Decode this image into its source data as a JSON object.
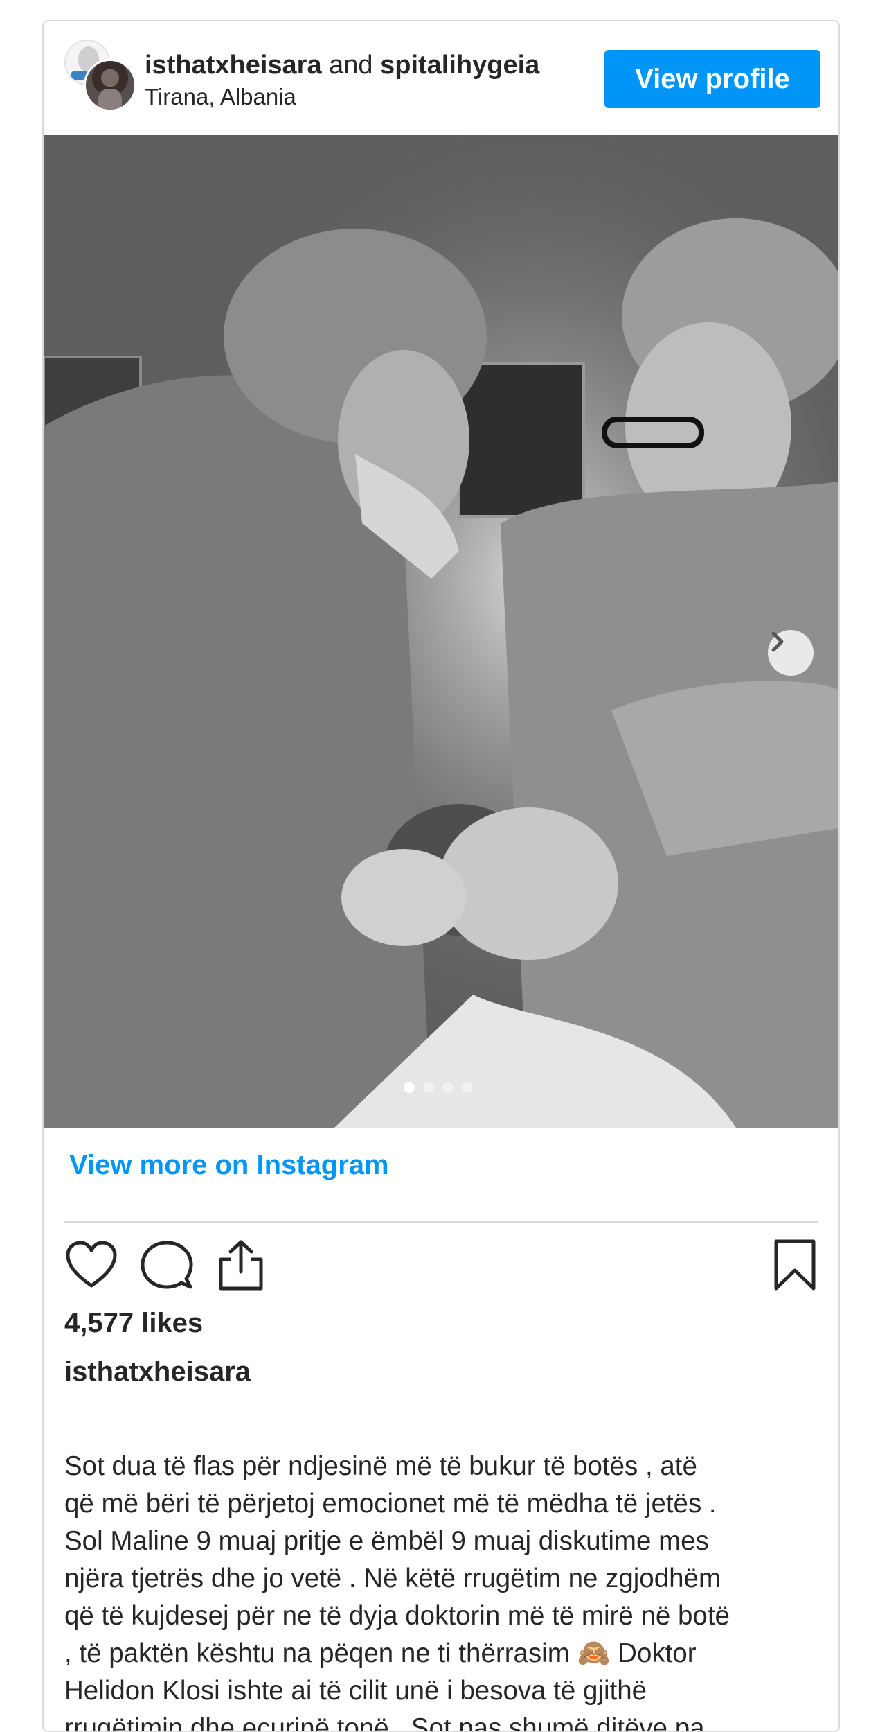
{
  "header": {
    "user1": "isthatxheisara",
    "joiner": " and ",
    "user2": "spitalihygeia",
    "location": "Tirana, Albania",
    "view_profile": "View profile"
  },
  "carousel": {
    "slides": 4,
    "active_index": 0
  },
  "view_more": "View more on Instagram",
  "likes": "4,577 likes",
  "caption_user": "isthatxheisara",
  "caption_text": "Sot dua të flas për ndjesinë më të bukur të botës , atë\nqë më bëri të përjetoj emocionet më të mëdha të jetës .\nSol Maline 9 muaj pritje e ëmbël 9 muaj diskutime mes\nnjëra tjetrës dhe jo vetë . Në këtë rrugëtim ne zgjodhëm\nqë të kujdesej për ne të dyja doktorin më të mirë në botë\n, të paktën kështu na pëqen ne ti thërrasim 🙈 Doktor\nHelidon Klosi ishte ai të cilit unë i besova të gjithë\nrrugëtimin dhe ecurinë tonë . Sot pas shumë ditëve pa",
  "colors": {
    "accent": "#0095f6",
    "text": "#262626",
    "border": "#dbdbdb"
  }
}
